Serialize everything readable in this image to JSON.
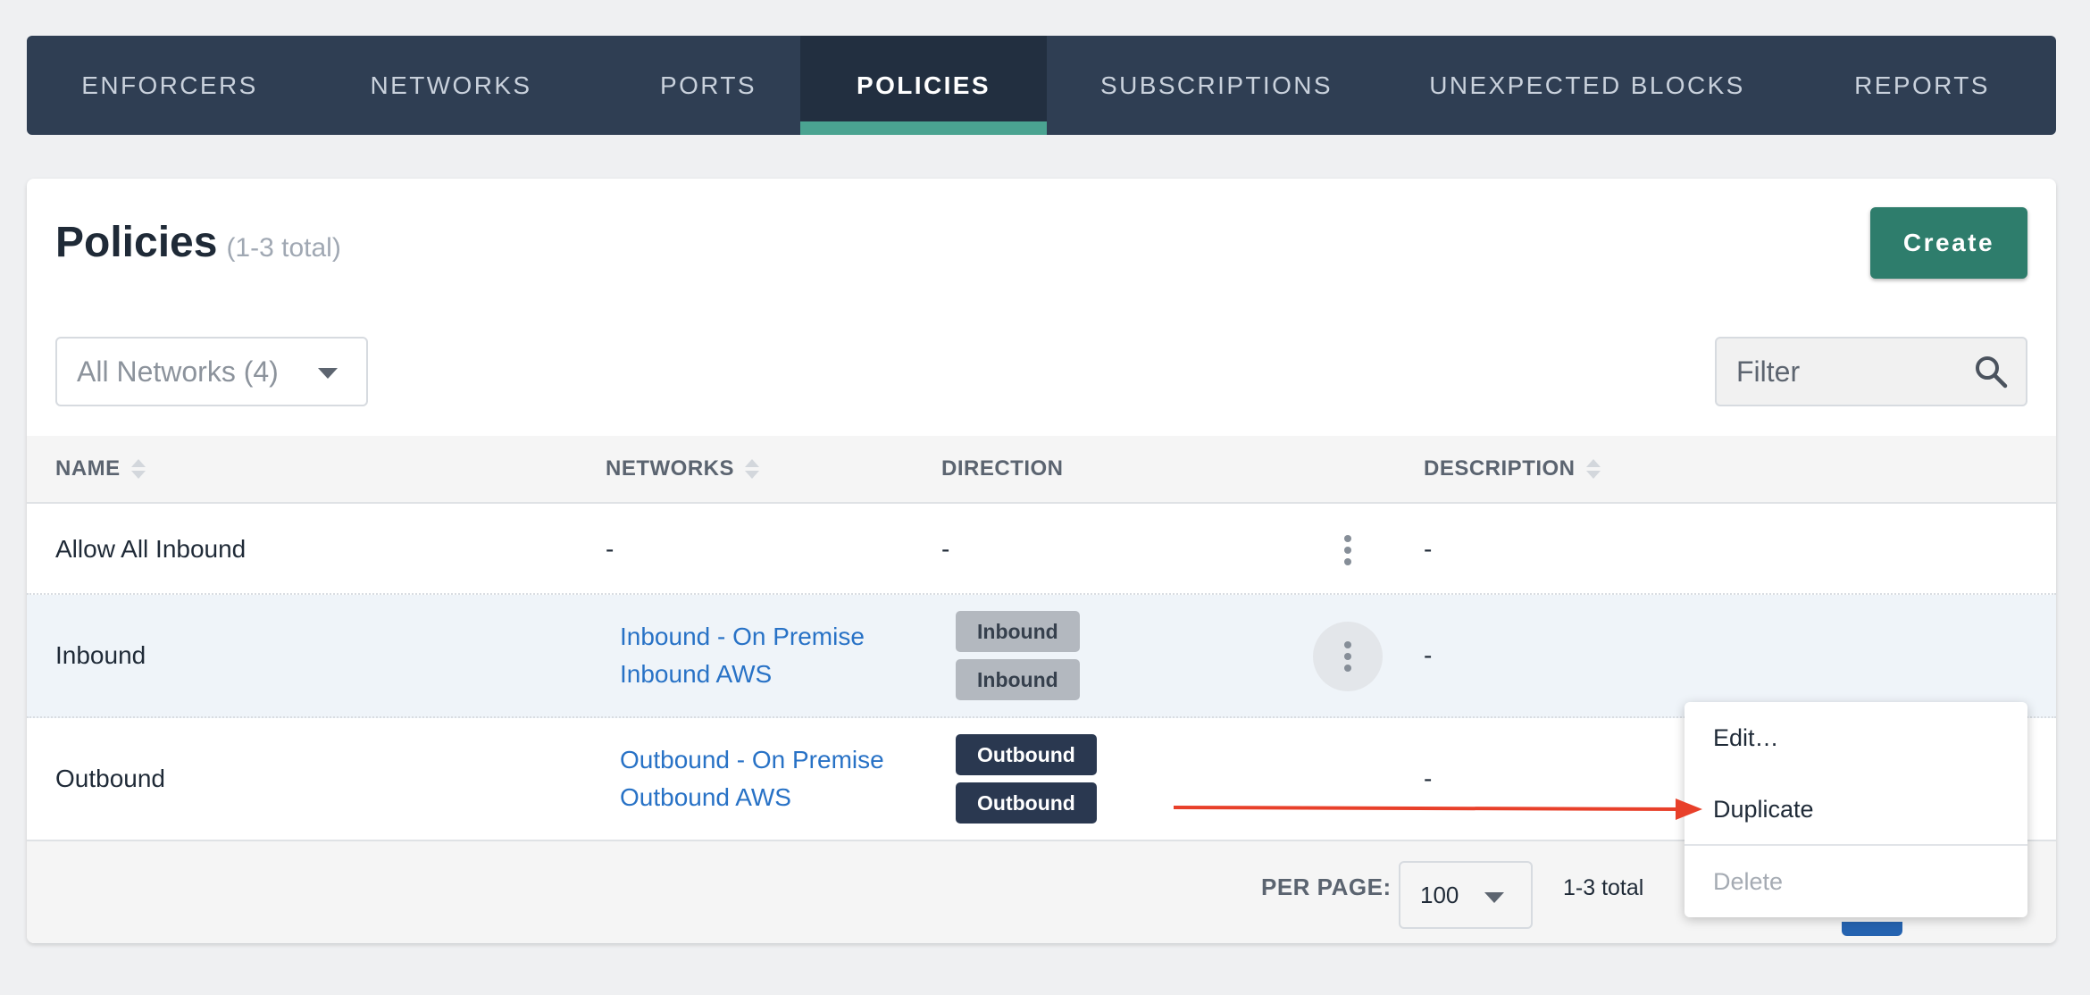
{
  "nav": {
    "tabs": [
      {
        "label": "ENFORCERS"
      },
      {
        "label": "NETWORKS"
      },
      {
        "label": "PORTS"
      },
      {
        "label": "POLICIES"
      },
      {
        "label": "SUBSCRIPTIONS"
      },
      {
        "label": "UNEXPECTED BLOCKS"
      },
      {
        "label": "REPORTS"
      }
    ],
    "active": "POLICIES"
  },
  "header": {
    "title": "Policies",
    "count": "(1-3 total)",
    "create_label": "Create"
  },
  "toolbar": {
    "network_select": "All Networks (4)",
    "filter_placeholder": "Filter"
  },
  "table": {
    "columns": {
      "name": "NAME",
      "networks": "NETWORKS",
      "direction": "DIRECTION",
      "description": "DESCRIPTION"
    },
    "rows": [
      {
        "name": "Allow All Inbound",
        "networks_dash": "-",
        "direction_dash": "-",
        "description": "-"
      },
      {
        "name": "Inbound",
        "networks": [
          "Inbound - On Premise",
          "Inbound AWS"
        ],
        "directions": [
          "Inbound",
          "Inbound"
        ],
        "description": "-"
      },
      {
        "name": "Outbound",
        "networks": [
          "Outbound - On Premise",
          "Outbound AWS"
        ],
        "directions": [
          "Outbound",
          "Outbound"
        ],
        "description": "-"
      }
    ]
  },
  "footer": {
    "per_page_label": "PER PAGE:",
    "per_page_value": "100",
    "range": "1-3 total"
  },
  "row_menu": {
    "items": [
      {
        "label": "Edit…"
      },
      {
        "label": "Duplicate"
      },
      {
        "label": "Delete"
      }
    ]
  },
  "colors": {
    "nav_bg": "#2f3e53",
    "nav_active_bg": "#222f40",
    "nav_active_underline": "#4aa391",
    "create_button": "#2e7d6c",
    "link": "#2872c6",
    "badge_inbound": "#b3b8bf",
    "badge_outbound": "#2a3850",
    "annotation_arrow": "#e8402a"
  }
}
